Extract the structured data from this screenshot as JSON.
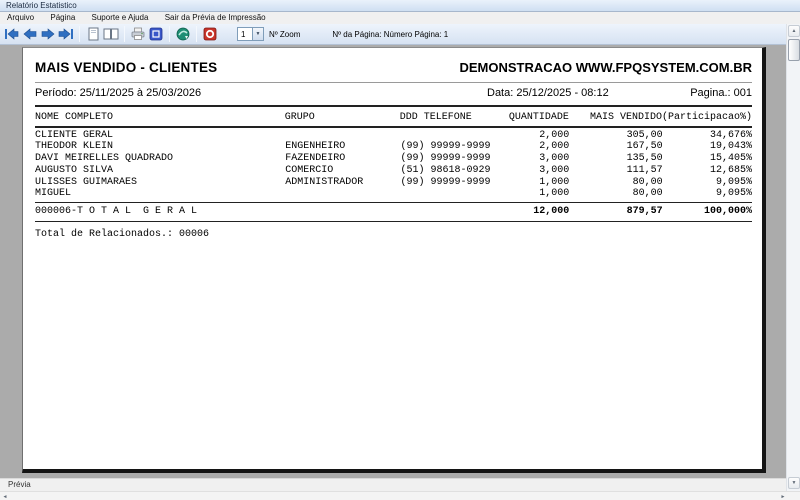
{
  "window": {
    "title": "Relatório Estatistico"
  },
  "menu": {
    "items": [
      "Arquivo",
      "Página",
      "Suporte e Ajuda",
      "Sair da Prévia de Impressão"
    ]
  },
  "toolbar": {
    "icons": [
      "first-page",
      "previous-page",
      "next-page",
      "last-page",
      "single-page-view",
      "two-page-view",
      "print",
      "print-setup",
      "export",
      "exit"
    ],
    "zoom_value": "1",
    "zoom_label": "Nº Zoom",
    "page_info": "Nº da Página: Número Página: 1"
  },
  "report": {
    "title": "MAIS VENDIDO - CLIENTES",
    "company": "DEMONSTRACAO WWW.FPQSYSTEM.COM.BR",
    "period": "Período: 25/11/2025 à 25/03/2026",
    "date": "Data: 25/12/2025 - 08:12",
    "page_number": "Pagina.: 001",
    "columns": [
      "NOME COMPLETO",
      "GRUPO",
      "DDD TELEFONE",
      "QUANTIDADE",
      "MAIS VENDIDO",
      "(Participacao%)"
    ],
    "rows": [
      {
        "name": "CLIENTE GERAL",
        "group": "",
        "phone": "",
        "qty": "2,000",
        "sold": "305,00",
        "share": "34,676%"
      },
      {
        "name": "THEODOR KLEIN",
        "group": "ENGENHEIRO",
        "phone": "(99) 99999-9999",
        "qty": "2,000",
        "sold": "167,50",
        "share": "19,043%"
      },
      {
        "name": "DAVI MEIRELLES QUADRADO",
        "group": "FAZENDEIRO",
        "phone": "(99) 99999-9999",
        "qty": "3,000",
        "sold": "135,50",
        "share": "15,405%"
      },
      {
        "name": "AUGUSTO SILVA",
        "group": "COMERCIO",
        "phone": "(51) 98618-0929",
        "qty": "3,000",
        "sold": "111,57",
        "share": "12,685%"
      },
      {
        "name": "ULISSES GUIMARAES",
        "group": "ADMINISTRADOR",
        "phone": "(99) 99999-9999",
        "qty": "1,000",
        "sold": "80,00",
        "share": "9,095%"
      },
      {
        "name": "MIGUEL",
        "group": "",
        "phone": "",
        "qty": "1,000",
        "sold": "80,00",
        "share": "9,095%"
      }
    ],
    "total": {
      "label": "000006-T O T A L  G E R A L",
      "qty": "12,000",
      "sold": "879,57",
      "share": "100,000%"
    },
    "footer": "Total de Relacionados.: 00006"
  },
  "statusbar": {
    "label": "Prévia"
  },
  "colors": {
    "titlebar_bg": "#dce8f7",
    "toolbar_bg": "#dde8f6",
    "workspace_bg": "#ababab",
    "arrow_blue": "#2f6fc1",
    "setup_blue": "#3a57c9",
    "export_green": "#1e8e74",
    "exit_red": "#c8352b"
  }
}
